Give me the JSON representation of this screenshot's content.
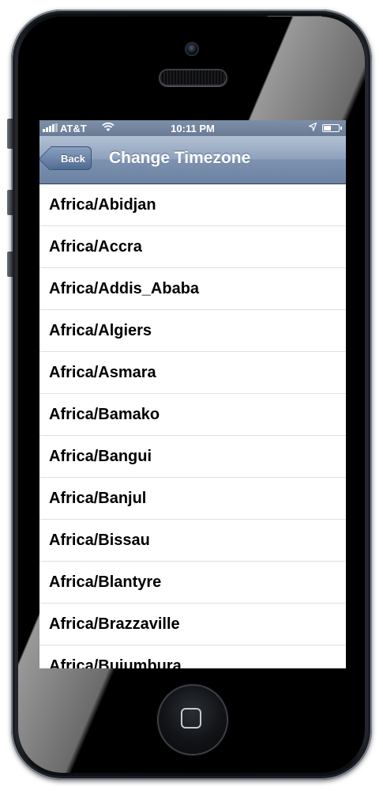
{
  "status_bar": {
    "carrier": "AT&T",
    "time": "10:11 PM",
    "icons": [
      "signal-icon",
      "wifi-icon",
      "location-arrow-icon",
      "battery-icon"
    ]
  },
  "nav_bar": {
    "back_label": "Back",
    "title": "Change Timezone"
  },
  "timezones": [
    "Africa/Abidjan",
    "Africa/Accra",
    "Africa/Addis_Ababa",
    "Africa/Algiers",
    "Africa/Asmara",
    "Africa/Bamako",
    "Africa/Bangui",
    "Africa/Banjul",
    "Africa/Bissau",
    "Africa/Blantyre",
    "Africa/Brazzaville",
    "Africa/Bujumbura"
  ],
  "colors": {
    "nav_bar": "#8ea2bd",
    "status_bar": "#6a7b96",
    "list_text": "#000000",
    "separator": "#e0e0e0"
  }
}
